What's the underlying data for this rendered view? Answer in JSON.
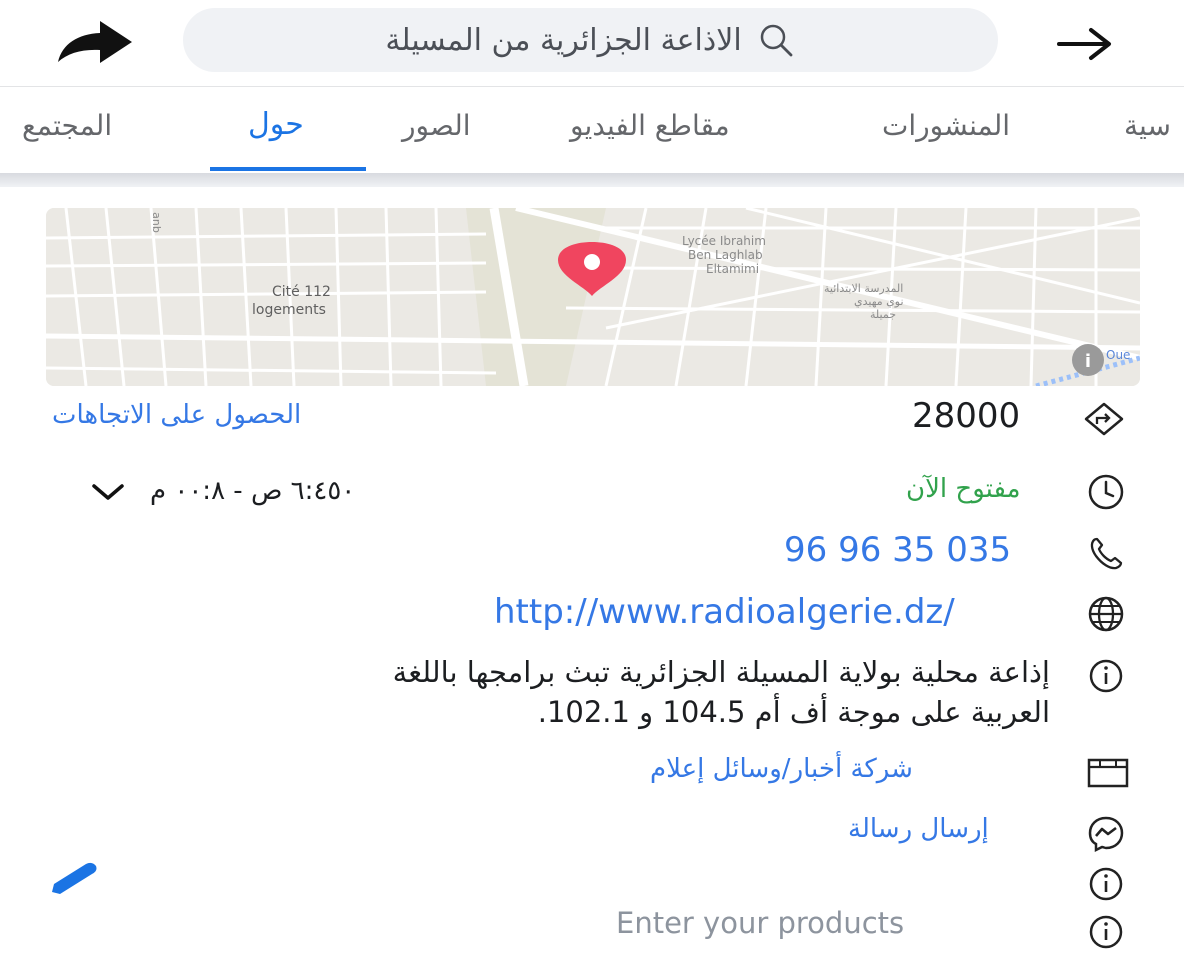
{
  "header": {
    "search_text": "الاذاعة الجزائرية من المسيلة"
  },
  "tabs": [
    {
      "label": "سية"
    },
    {
      "label": "المنشورات"
    },
    {
      "label": "مقاطع الفيديو"
    },
    {
      "label": "الصور"
    },
    {
      "label": "حول",
      "active": true
    },
    {
      "label": "المجتمع"
    }
  ],
  "map": {
    "labels": {
      "cite": "Cité 112",
      "logements": "logements",
      "lycee1": "Lycée Ibrahim",
      "lycee2": "Ben Laghlab",
      "lycee3": "Eltamimi",
      "school1": "المدرسة الابتدائية",
      "school2": "نوي مهيدي",
      "school3": "جميلة",
      "road": "anb",
      "corner": "Oue"
    }
  },
  "info": {
    "postal_code": "28000",
    "directions_link": "الحصول على الاتجاهات",
    "open_status": "مفتوح الآن",
    "hours": "٦:٤٥٠ ص - ٠٠:٨ م",
    "phone": "96 96 35 035",
    "website": "http://www.radioalgerie.dz/",
    "description_line1": "إذاعة محلية بولاية المسيلة الجزائرية تبث برامجها باللغة",
    "description_line2": "العربية على موجة أف أم 104.5 و 102.1.",
    "category": "شركة أخبار/وسائل إعلام",
    "send_message": "إرسال رسالة",
    "products_placeholder": "Enter your products"
  },
  "colors": {
    "accent": "#1b74e4",
    "link": "#3578e5",
    "open": "#31a24c",
    "pin": "#f0455f"
  }
}
